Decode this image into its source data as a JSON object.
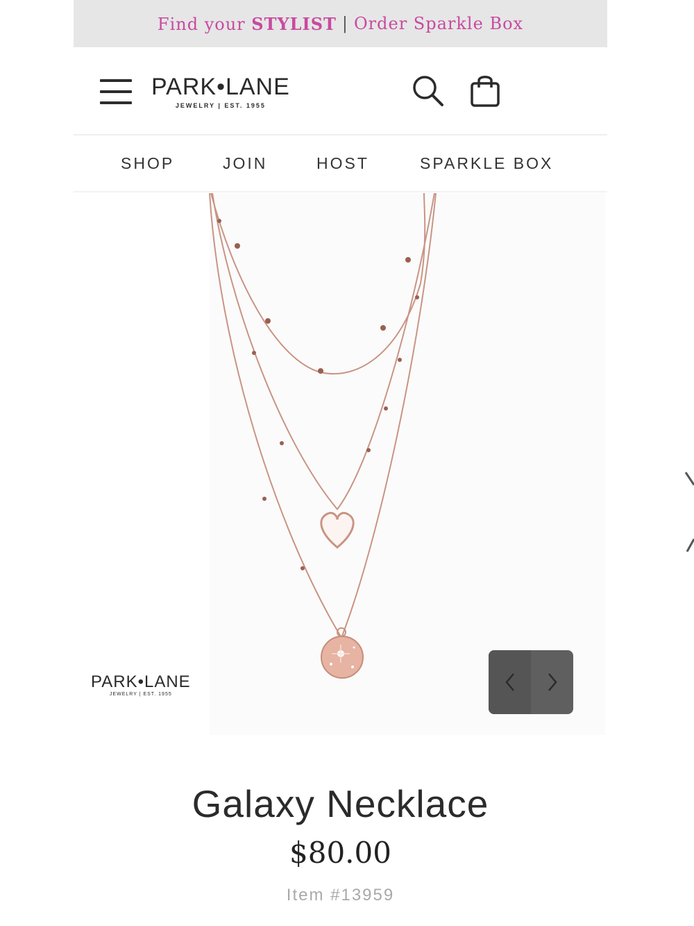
{
  "promo": {
    "find_prefix": "Find your ",
    "find_emphasis": "STYLIST",
    "separator": "|",
    "order_link": "Order Sparkle Box"
  },
  "header": {
    "logo_name": "PARK•LANE",
    "logo_tagline": "JEWELRY | EST. 1955"
  },
  "nav": {
    "items": [
      "SHOP",
      "JOIN",
      "HOST",
      "SPARKLE BOX"
    ]
  },
  "gallery": {
    "watermark_name": "PARK•LANE",
    "watermark_tagline": "JEWELRY | EST. 1955"
  },
  "product": {
    "title": "Galaxy Necklace",
    "price": "$80.00",
    "item_number": "Item #13959"
  },
  "icons": {
    "menu": "hamburger-menu-icon",
    "search": "search-icon",
    "bag": "shopping-bag-icon",
    "prev": "chevron-left-icon",
    "next": "chevron-right-icon"
  },
  "colors": {
    "promo_text": "#c84aa0",
    "promo_bg": "#e6e6e6",
    "chain": "#c99483",
    "text": "#2b2b2b"
  }
}
